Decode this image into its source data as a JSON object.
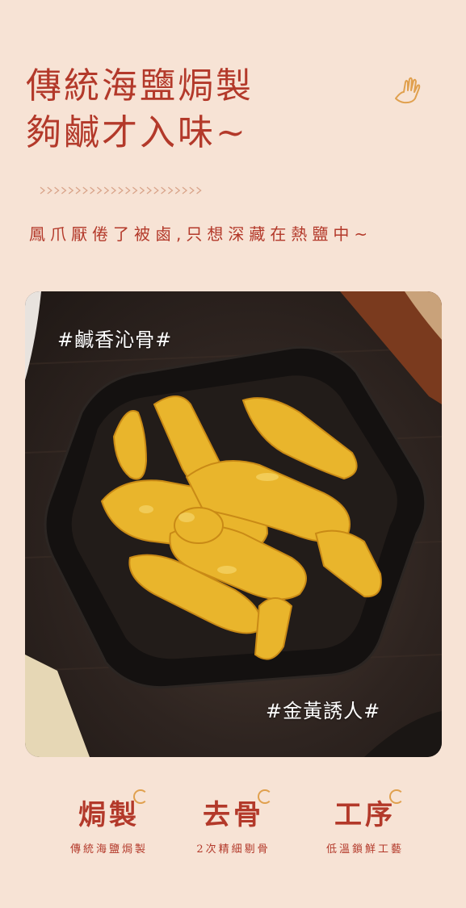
{
  "header": {
    "title_line1": "傳統海鹽焗製",
    "title_line2": "夠鹹才入味~",
    "subtitle": "鳳爪厭倦了被鹵,只想深藏在熱鹽中~"
  },
  "photo": {
    "tag_top": "#鹹香沁骨#",
    "tag_bottom": "#金黃誘人#"
  },
  "features": [
    {
      "title": "焗製",
      "caption": "傳統海鹽焗製"
    },
    {
      "title": "去骨",
      "caption": "2次精細剔骨"
    },
    {
      "title": "工序",
      "caption": "低溫鎖鮮工藝"
    }
  ],
  "colors": {
    "background": "#f7e3d5",
    "accent_red": "#b3392a",
    "accent_gold": "#e0a04e"
  },
  "icons": [
    "hand-icon",
    "chevron-divider-icon"
  ]
}
